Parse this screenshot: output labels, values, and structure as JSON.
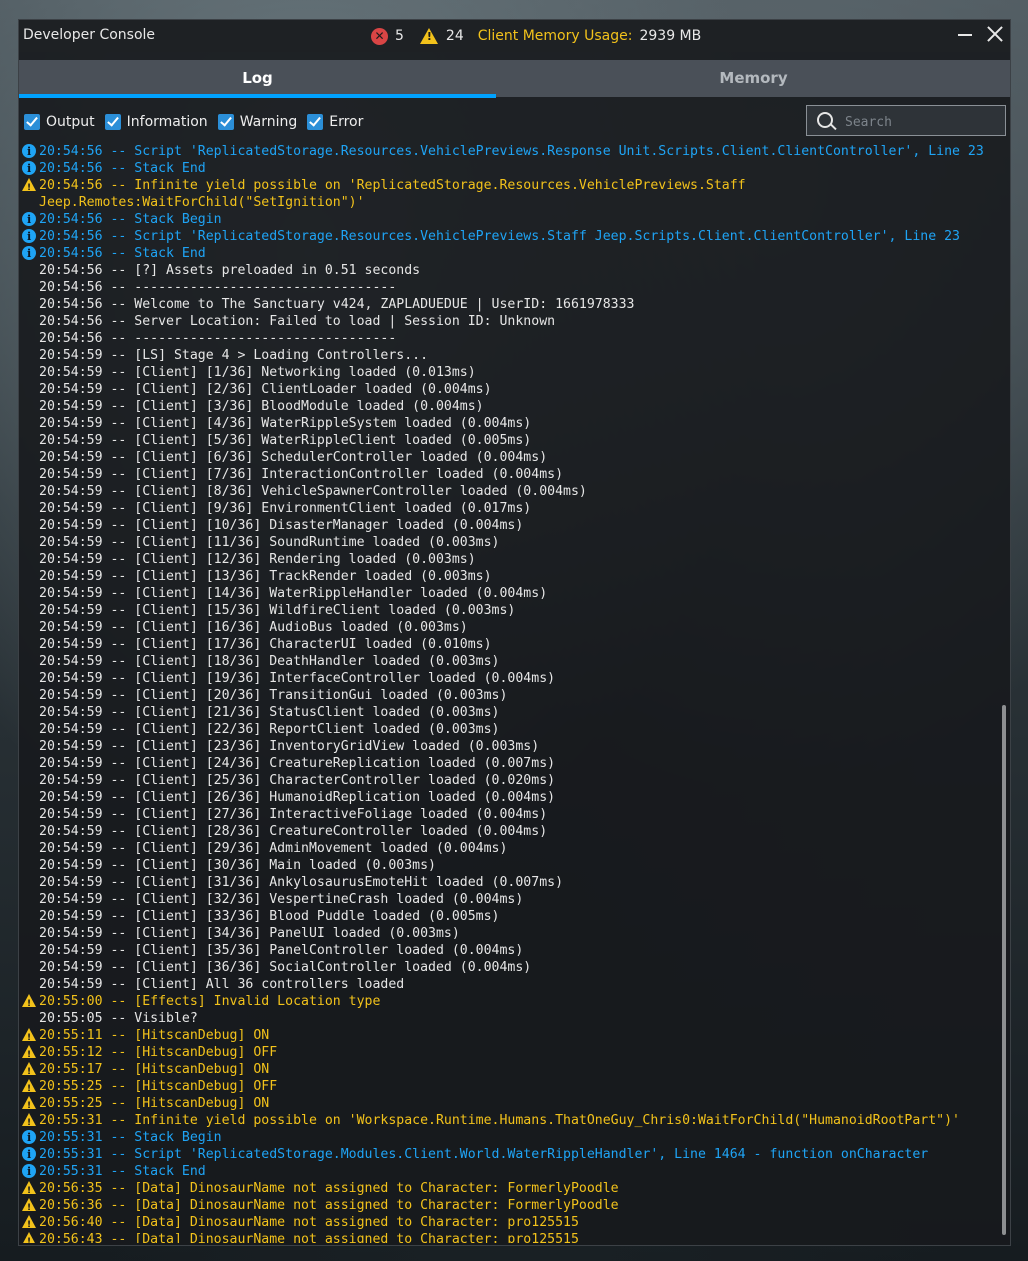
{
  "window": {
    "title": "Developer Console",
    "error_count": "5",
    "warning_count": "24",
    "memory_label": "Client Memory Usage:",
    "memory_value": "2939 MB"
  },
  "tabs": {
    "log": "Log",
    "memory": "Memory"
  },
  "filters": {
    "output": "Output",
    "information": "Information",
    "warning": "Warning",
    "error": "Error"
  },
  "search": {
    "placeholder": "Search"
  },
  "log": [
    {
      "t": "info",
      "text": "20:54:56 -- Script 'ReplicatedStorage.Resources.VehiclePreviews.Response Unit.Scripts.Client.ClientController', Line 23"
    },
    {
      "t": "info",
      "text": "20:54:56 -- Stack End"
    },
    {
      "t": "warn",
      "text": "20:54:56 -- Infinite yield possible on 'ReplicatedStorage.Resources.VehiclePreviews.Staff Jeep.Remotes:WaitForChild(\"SetIgnition\")'",
      "wrap": true
    },
    {
      "t": "info",
      "text": "20:54:56 -- Stack Begin"
    },
    {
      "t": "info",
      "text": "20:54:56 -- Script 'ReplicatedStorage.Resources.VehiclePreviews.Staff Jeep.Scripts.Client.ClientController', Line 23"
    },
    {
      "t": "info",
      "text": "20:54:56 -- Stack End"
    },
    {
      "t": "out",
      "text": "20:54:56 -- [?] Assets preloaded in 0.51 seconds"
    },
    {
      "t": "out",
      "text": "20:54:56 -- ---------------------------------"
    },
    {
      "t": "out",
      "text": "20:54:56 -- Welcome to The Sanctuary v424, ZAPLADUEDUE | UserID: 1661978333"
    },
    {
      "t": "out",
      "text": "20:54:56 -- Server Location: Failed to load | Session ID: Unknown"
    },
    {
      "t": "out",
      "text": "20:54:56 -- ---------------------------------"
    },
    {
      "t": "out",
      "text": "20:54:59 -- [LS] Stage 4 > Loading Controllers..."
    },
    {
      "t": "out",
      "text": "20:54:59 -- [Client] [1/36] Networking loaded (0.013ms)"
    },
    {
      "t": "out",
      "text": "20:54:59 -- [Client] [2/36] ClientLoader loaded (0.004ms)"
    },
    {
      "t": "out",
      "text": "20:54:59 -- [Client] [3/36] BloodModule loaded (0.004ms)"
    },
    {
      "t": "out",
      "text": "20:54:59 -- [Client] [4/36] WaterRippleSystem loaded (0.004ms)"
    },
    {
      "t": "out",
      "text": "20:54:59 -- [Client] [5/36] WaterRippleClient loaded (0.005ms)"
    },
    {
      "t": "out",
      "text": "20:54:59 -- [Client] [6/36] SchedulerController loaded (0.004ms)"
    },
    {
      "t": "out",
      "text": "20:54:59 -- [Client] [7/36] InteractionController loaded (0.004ms)"
    },
    {
      "t": "out",
      "text": "20:54:59 -- [Client] [8/36] VehicleSpawnerController loaded (0.004ms)"
    },
    {
      "t": "out",
      "text": "20:54:59 -- [Client] [9/36] EnvironmentClient loaded (0.017ms)"
    },
    {
      "t": "out",
      "text": "20:54:59 -- [Client] [10/36] DisasterManager loaded (0.004ms)"
    },
    {
      "t": "out",
      "text": "20:54:59 -- [Client] [11/36] SoundRuntime loaded (0.003ms)"
    },
    {
      "t": "out",
      "text": "20:54:59 -- [Client] [12/36] Rendering loaded (0.003ms)"
    },
    {
      "t": "out",
      "text": "20:54:59 -- [Client] [13/36] TrackRender loaded (0.003ms)"
    },
    {
      "t": "out",
      "text": "20:54:59 -- [Client] [14/36] WaterRippleHandler loaded (0.004ms)"
    },
    {
      "t": "out",
      "text": "20:54:59 -- [Client] [15/36] WildfireClient loaded (0.003ms)"
    },
    {
      "t": "out",
      "text": "20:54:59 -- [Client] [16/36] AudioBus loaded (0.003ms)"
    },
    {
      "t": "out",
      "text": "20:54:59 -- [Client] [17/36] CharacterUI loaded (0.010ms)"
    },
    {
      "t": "out",
      "text": "20:54:59 -- [Client] [18/36] DeathHandler loaded (0.003ms)"
    },
    {
      "t": "out",
      "text": "20:54:59 -- [Client] [19/36] InterfaceController loaded (0.004ms)"
    },
    {
      "t": "out",
      "text": "20:54:59 -- [Client] [20/36] TransitionGui loaded (0.003ms)"
    },
    {
      "t": "out",
      "text": "20:54:59 -- [Client] [21/36] StatusClient loaded (0.003ms)"
    },
    {
      "t": "out",
      "text": "20:54:59 -- [Client] [22/36] ReportClient loaded (0.003ms)"
    },
    {
      "t": "out",
      "text": "20:54:59 -- [Client] [23/36] InventoryGridView loaded (0.003ms)"
    },
    {
      "t": "out",
      "text": "20:54:59 -- [Client] [24/36] CreatureReplication loaded (0.007ms)"
    },
    {
      "t": "out",
      "text": "20:54:59 -- [Client] [25/36] CharacterController loaded (0.020ms)"
    },
    {
      "t": "out",
      "text": "20:54:59 -- [Client] [26/36] HumanoidReplication loaded (0.004ms)"
    },
    {
      "t": "out",
      "text": "20:54:59 -- [Client] [27/36] InteractiveFoliage loaded (0.004ms)"
    },
    {
      "t": "out",
      "text": "20:54:59 -- [Client] [28/36] CreatureController loaded (0.004ms)"
    },
    {
      "t": "out",
      "text": "20:54:59 -- [Client] [29/36] AdminMovement loaded (0.004ms)"
    },
    {
      "t": "out",
      "text": "20:54:59 -- [Client] [30/36] Main loaded (0.003ms)"
    },
    {
      "t": "out",
      "text": "20:54:59 -- [Client] [31/36] AnkylosaurusEmoteHit loaded (0.007ms)"
    },
    {
      "t": "out",
      "text": "20:54:59 -- [Client] [32/36] VespertineCrash loaded (0.004ms)"
    },
    {
      "t": "out",
      "text": "20:54:59 -- [Client] [33/36] Blood Puddle loaded (0.005ms)"
    },
    {
      "t": "out",
      "text": "20:54:59 -- [Client] [34/36] PanelUI loaded (0.003ms)"
    },
    {
      "t": "out",
      "text": "20:54:59 -- [Client] [35/36] PanelController loaded (0.004ms)"
    },
    {
      "t": "out",
      "text": "20:54:59 -- [Client] [36/36] SocialController loaded (0.004ms)"
    },
    {
      "t": "out",
      "text": "20:54:59 -- [Client] All 36 controllers loaded"
    },
    {
      "t": "warn",
      "text": "20:55:00 -- [Effects] Invalid Location type"
    },
    {
      "t": "out",
      "text": "20:55:05 -- Visible?"
    },
    {
      "t": "warn",
      "text": "20:55:11 -- [HitscanDebug] ON"
    },
    {
      "t": "warn",
      "text": "20:55:12 -- [HitscanDebug] OFF"
    },
    {
      "t": "warn",
      "text": "20:55:17 -- [HitscanDebug] ON"
    },
    {
      "t": "warn",
      "text": "20:55:25 -- [HitscanDebug] OFF"
    },
    {
      "t": "warn",
      "text": "20:55:25 -- [HitscanDebug] ON"
    },
    {
      "t": "warn",
      "text": "20:55:31 -- Infinite yield possible on 'Workspace.Runtime.Humans.ThatOneGuy_Chris0:WaitForChild(\"HumanoidRootPart\")'"
    },
    {
      "t": "info",
      "text": "20:55:31 -- Stack Begin"
    },
    {
      "t": "info",
      "text": "20:55:31 -- Script 'ReplicatedStorage.Modules.Client.World.WaterRippleHandler', Line 1464 - function onCharacter"
    },
    {
      "t": "info",
      "text": "20:55:31 -- Stack End"
    },
    {
      "t": "warn",
      "text": "20:56:35 -- [Data] DinosaurName not assigned to Character: FormerlyPoodle"
    },
    {
      "t": "warn",
      "text": "20:56:36 -- [Data] DinosaurName not assigned to Character: FormerlyPoodle"
    },
    {
      "t": "warn",
      "text": "20:56:40 -- [Data] DinosaurName not assigned to Character: pro125515"
    },
    {
      "t": "warn",
      "text": "20:56:43 -- [Data] DinosaurName not assigned to Character: pro125515"
    }
  ]
}
